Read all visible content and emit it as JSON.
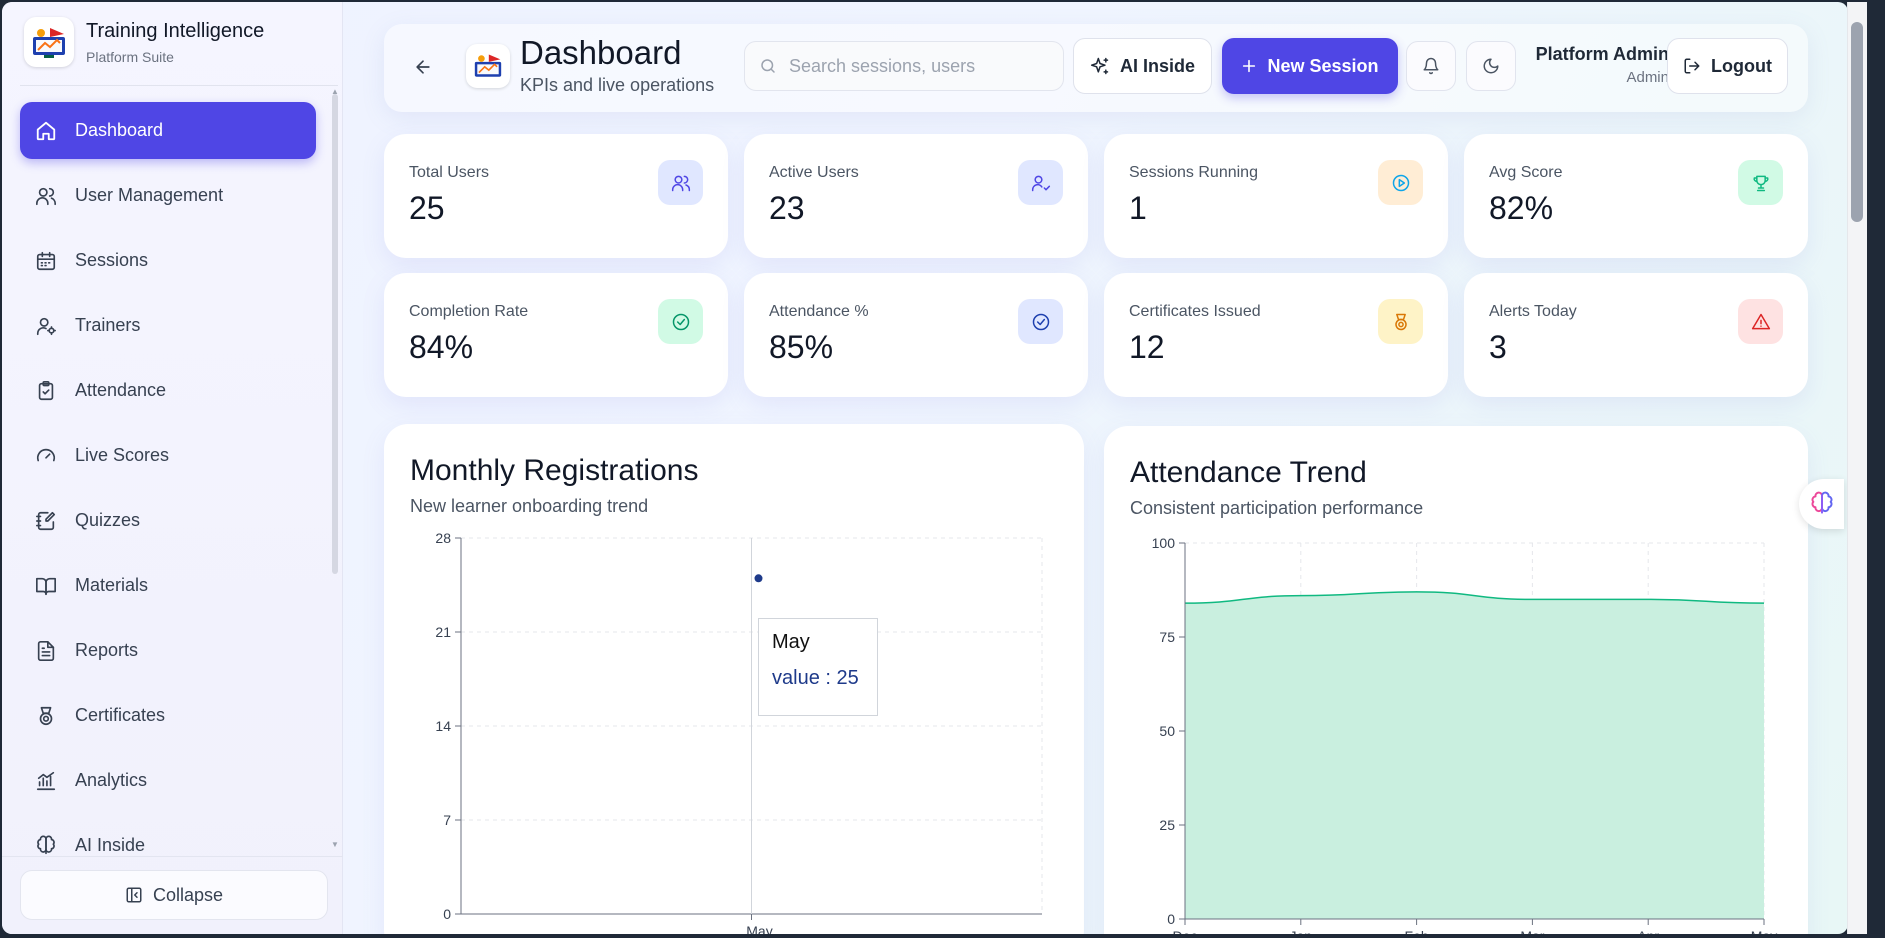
{
  "brand": {
    "title": "Training Intelligence",
    "subtitle": "Platform Suite"
  },
  "sidebar": {
    "items": [
      {
        "label": "Dashboard",
        "icon": "home-icon",
        "active": true
      },
      {
        "label": "User Management",
        "icon": "users-icon"
      },
      {
        "label": "Sessions",
        "icon": "calendar-icon"
      },
      {
        "label": "Trainers",
        "icon": "user-cog-icon"
      },
      {
        "label": "Attendance",
        "icon": "clipboard-check-icon"
      },
      {
        "label": "Live Scores",
        "icon": "gauge-icon"
      },
      {
        "label": "Quizzes",
        "icon": "notebook-pen-icon"
      },
      {
        "label": "Materials",
        "icon": "book-open-icon"
      },
      {
        "label": "Reports",
        "icon": "file-text-icon"
      },
      {
        "label": "Certificates",
        "icon": "award-icon"
      },
      {
        "label": "Analytics",
        "icon": "chart-line-icon"
      },
      {
        "label": "AI Inside",
        "icon": "brain-circuit-icon"
      }
    ],
    "collapse_label": "Collapse"
  },
  "header": {
    "title": "Dashboard",
    "subtitle": "KPIs and live operations",
    "search_placeholder": "Search sessions, users",
    "ai_label": "AI Inside",
    "new_session_label": "New Session",
    "user_name": "Platform Admin",
    "user_role": "Admin",
    "logout_label": "Logout"
  },
  "kpis": [
    {
      "label": "Total Users",
      "value": "25",
      "icon": "users-icon",
      "color": "#4f46e5",
      "bg": "#e0e7ff"
    },
    {
      "label": "Active Users",
      "value": "23",
      "icon": "user-check-icon",
      "color": "#4f46e5",
      "bg": "#e0e7ff"
    },
    {
      "label": "Sessions Running",
      "value": "1",
      "icon": "play-circle-icon",
      "color": "#0ea5e9",
      "bg": "#ffedd5"
    },
    {
      "label": "Avg Score",
      "value": "82%",
      "icon": "trophy-icon",
      "color": "#10b981",
      "bg": "#d1fae5"
    },
    {
      "label": "Completion Rate",
      "value": "84%",
      "icon": "check-circle-icon",
      "color": "#059669",
      "bg": "#d1fae5"
    },
    {
      "label": "Attendance %",
      "value": "85%",
      "icon": "badge-check-icon",
      "color": "#1e40af",
      "bg": "#e0e7ff"
    },
    {
      "label": "Certificates Issued",
      "value": "12",
      "icon": "medal-icon",
      "color": "#d97706",
      "bg": "#fef3c7"
    },
    {
      "label": "Alerts Today",
      "value": "3",
      "icon": "alert-triangle-icon",
      "color": "#dc2626",
      "bg": "#fee2e2"
    }
  ],
  "registrations": {
    "title": "Monthly Registrations",
    "subtitle": "New learner onboarding trend",
    "tooltip_title": "May",
    "tooltip_value": "value : 25"
  },
  "attendance": {
    "title": "Attendance Trend",
    "subtitle": "Consistent participation performance"
  },
  "chart_data": [
    {
      "type": "scatter",
      "title": "Monthly Registrations",
      "categories": [
        "May"
      ],
      "values": [
        25
      ],
      "yticks": [
        0,
        7,
        14,
        21,
        28
      ],
      "ylim": [
        0,
        28
      ],
      "grid": true,
      "color": "#1e3a8a"
    },
    {
      "type": "area",
      "title": "Attendance Trend",
      "categories": [
        "Dec",
        "Jan",
        "Feb",
        "Mar",
        "Apr",
        "May"
      ],
      "values": [
        84,
        86,
        87,
        85,
        85,
        84
      ],
      "yticks": [
        0,
        25,
        50,
        75,
        100
      ],
      "ylim": [
        0,
        100
      ],
      "grid": true,
      "color": "#10b981",
      "fill": "#c9efdf"
    }
  ]
}
